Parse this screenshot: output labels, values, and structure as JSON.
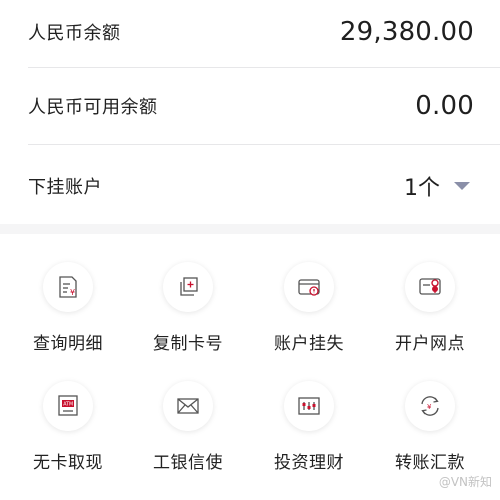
{
  "accounts": {
    "rmb_balance": {
      "label": "人民币余额",
      "value": "29,380.00"
    },
    "rmb_available": {
      "label": "人民币可用余额",
      "value": "0.00"
    },
    "sub_accounts": {
      "label": "下挂账户",
      "value": "1个"
    }
  },
  "actions": [
    {
      "label": "查询明细",
      "icon": "transaction-details-icon"
    },
    {
      "label": "复制卡号",
      "icon": "copy-card-number-icon"
    },
    {
      "label": "账户挂失",
      "icon": "report-loss-icon"
    },
    {
      "label": "开户网点",
      "icon": "branch-location-icon"
    },
    {
      "label": "无卡取现",
      "icon": "atm-icon"
    },
    {
      "label": "工银信使",
      "icon": "envelope-icon"
    },
    {
      "label": "投资理财",
      "icon": "investment-icon"
    },
    {
      "label": "转账汇款",
      "icon": "transfer-icon"
    }
  ],
  "watermark": {
    "text": "@VN新知"
  },
  "colors": {
    "icon_stroke": "#555555",
    "icon_accent": "#c8102e",
    "dropdown_arrow": "#8a8fa8"
  }
}
